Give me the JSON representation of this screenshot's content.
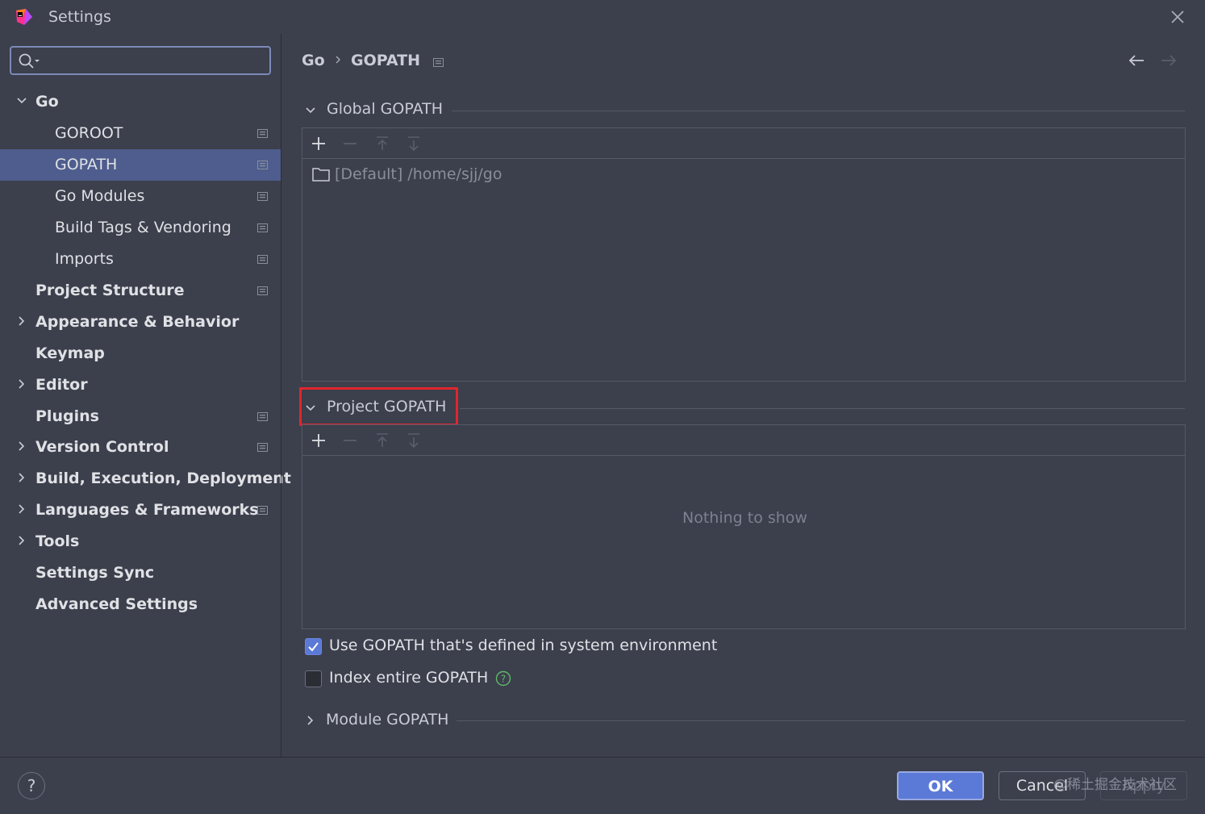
{
  "window": {
    "title": "Settings"
  },
  "sidebar": {
    "search": {
      "value": "",
      "placeholder": ""
    },
    "items": [
      {
        "label": "Go",
        "bold": true,
        "expanded": true
      },
      {
        "label": "GOROOT",
        "bold": false
      },
      {
        "label": "GOPATH",
        "bold": false,
        "selected": true
      },
      {
        "label": "Go Modules",
        "bold": false
      },
      {
        "label": "Build Tags & Vendoring",
        "bold": false
      },
      {
        "label": "Imports",
        "bold": false
      },
      {
        "label": "Project Structure",
        "bold": true
      },
      {
        "label": "Appearance & Behavior",
        "bold": true
      },
      {
        "label": "Keymap",
        "bold": true
      },
      {
        "label": "Editor",
        "bold": true
      },
      {
        "label": "Plugins",
        "bold": true
      },
      {
        "label": "Version Control",
        "bold": true
      },
      {
        "label": "Build, Execution, Deployment",
        "bold": true
      },
      {
        "label": "Languages & Frameworks",
        "bold": true
      },
      {
        "label": "Tools",
        "bold": true
      },
      {
        "label": "Settings Sync",
        "bold": true
      },
      {
        "label": "Advanced Settings",
        "bold": true
      }
    ]
  },
  "breadcrumb": {
    "parent": "Go",
    "current": "GOPATH"
  },
  "global_gopath": {
    "title": "Global GOPATH",
    "entries": [
      "[Default] /home/sjj/go"
    ]
  },
  "project_gopath": {
    "title": "Project GOPATH",
    "empty_text": "Nothing to show"
  },
  "options": {
    "use_system_env": {
      "label": "Use GOPATH that's defined in system environment",
      "checked": true
    },
    "index_entire": {
      "label": "Index entire GOPATH",
      "checked": false
    },
    "help_glyph": "?"
  },
  "module_gopath": {
    "title": "Module GOPATH"
  },
  "footer": {
    "help": "?",
    "ok": "OK",
    "cancel": "Cancel",
    "apply": "Apply",
    "watermark": "@稀土掘金技术社区"
  },
  "colors": {
    "background": "#3c3f4c",
    "selection": "#4e5d8d",
    "accent": "#5b79d6",
    "highlight_box": "#e0262e"
  },
  "icons": {
    "app": "jetbrains-logo-icon",
    "close": "close-icon",
    "search": "search-icon",
    "back": "arrow-left-icon",
    "forward": "arrow-right-icon",
    "add": "plus-icon",
    "remove": "minus-icon",
    "move_up": "arrow-up-icon",
    "move_down": "arrow-down-icon",
    "folder": "folder-icon",
    "page": "page-settings-icon"
  }
}
